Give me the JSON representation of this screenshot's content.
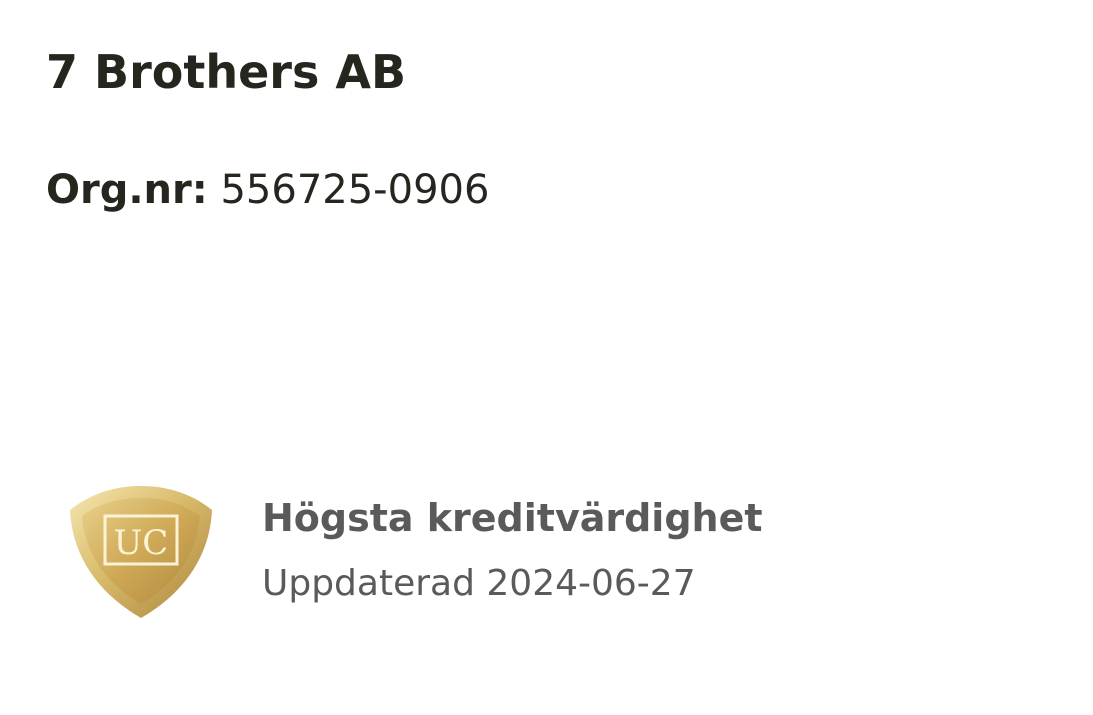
{
  "company": {
    "name": "7 Brothers AB",
    "org_label": "Org.nr:",
    "org_number": "556725-0906"
  },
  "rating": {
    "badge_icon": "uc-shield-icon",
    "badge_text": "UC",
    "title": "Högsta kreditvärdighet",
    "updated": "Uppdaterad 2024-06-27"
  },
  "colors": {
    "text_dark": "#26261f",
    "text_gray": "#5a5a5a",
    "gold_light": "#f3e2a6",
    "gold_mid": "#d8b867",
    "gold_dark": "#a9833a"
  }
}
